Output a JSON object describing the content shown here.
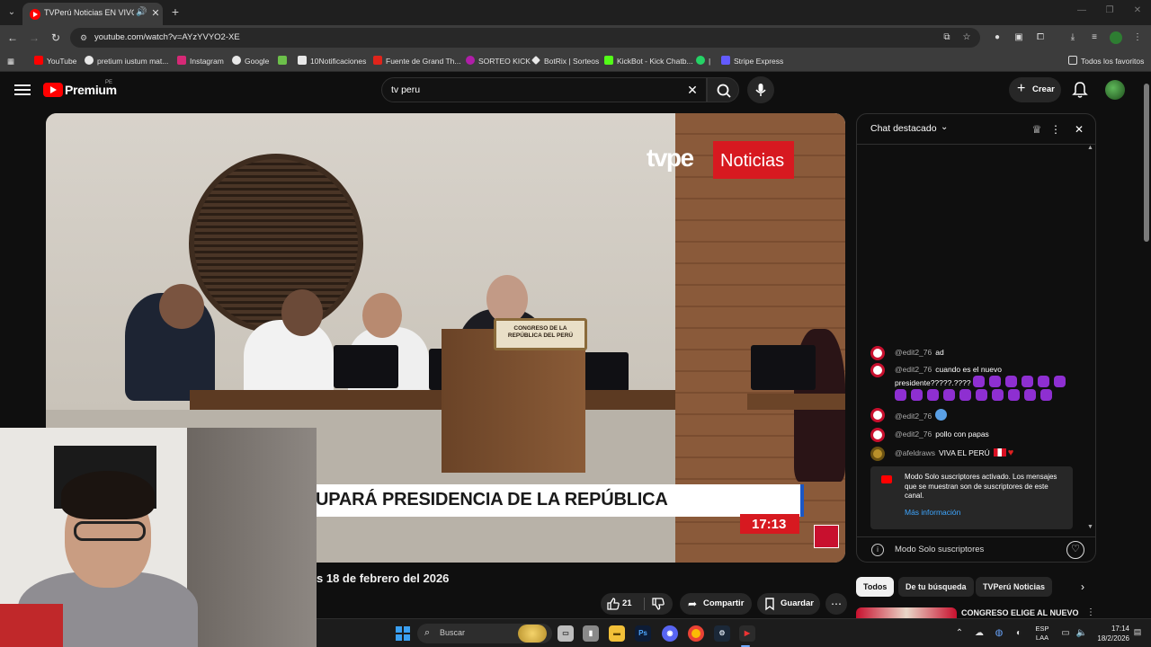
{
  "browser": {
    "tab_title": "TVPerú Noticias EN VIVO: N",
    "url": "youtube.com/watch?v=AYzYVYO2-XE",
    "bookmarks": [
      {
        "label": "YouTube",
        "color": "#ff0000"
      },
      {
        "label": "pretium iustum mat...",
        "color": "#e8e8e8"
      },
      {
        "label": "Instagram",
        "color": "#d62976"
      },
      {
        "label": "Google",
        "color": "#e8e8e8"
      },
      {
        "label": "",
        "color": "#6cc04a"
      },
      {
        "label": "10Notificaciones",
        "color": "#e8e8e8"
      },
      {
        "label": "Fuente de Grand Th...",
        "color": "#e0241b"
      },
      {
        "label": "SORTEO KICK",
        "color": "#b01ea8"
      },
      {
        "label": "BotRix | Sorteos",
        "color": "#e8e8e8"
      },
      {
        "label": "KickBot - Kick Chatb...",
        "color": "#53fc18"
      },
      {
        "label": "|",
        "color": "#25d366"
      },
      {
        "label": "Stripe Express",
        "color": "#635bff"
      }
    ],
    "all_bookmarks": "Todos los favoritos"
  },
  "youtube": {
    "brand": "Premium",
    "country": "PE",
    "search_query": "tv peru",
    "create_label": "Crear"
  },
  "video": {
    "overlay_brand": "tvpe",
    "overlay_brand_suffix": "Noticias",
    "podium_sign": "CONGRESO DE LA REPÚBLICA DEL PERÚ",
    "headline": "UPARÁ PRESIDENCIA DE LA REPÚBLICA",
    "clock": "17:13",
    "title": "s 18 de febrero del 2026",
    "likes": "21",
    "share_label": "Compartir",
    "save_label": "Guardar"
  },
  "chat": {
    "title": "Chat destacado",
    "messages": [
      {
        "author": "@edit2_76",
        "text": "ad"
      },
      {
        "author": "@edit2_76",
        "text": "cuando es el nuevo presidente?????.????"
      },
      {
        "author": "@edit2_76",
        "text": ""
      },
      {
        "author": "@edit2_76",
        "text": "pollo con papas"
      },
      {
        "author": "@afeldraws",
        "text": "VIVA EL PERÚ"
      }
    ],
    "notice_text": "Modo Solo suscriptores activado. Los mensajes que se muestran son de suscriptores de este canal.",
    "notice_link": "Más información",
    "footer_text": "Modo Solo suscriptores"
  },
  "chips": [
    "Todos",
    "De tu búsqueda",
    "TVPerú Noticias"
  ],
  "recommendation": {
    "title": "CONGRESO ELIGE AL NUEVO"
  },
  "taskbar": {
    "search_label": "Buscar",
    "lang_line1": "ESP",
    "lang_line2": "LAA",
    "time": "17:14",
    "date": "18/2/2026"
  }
}
